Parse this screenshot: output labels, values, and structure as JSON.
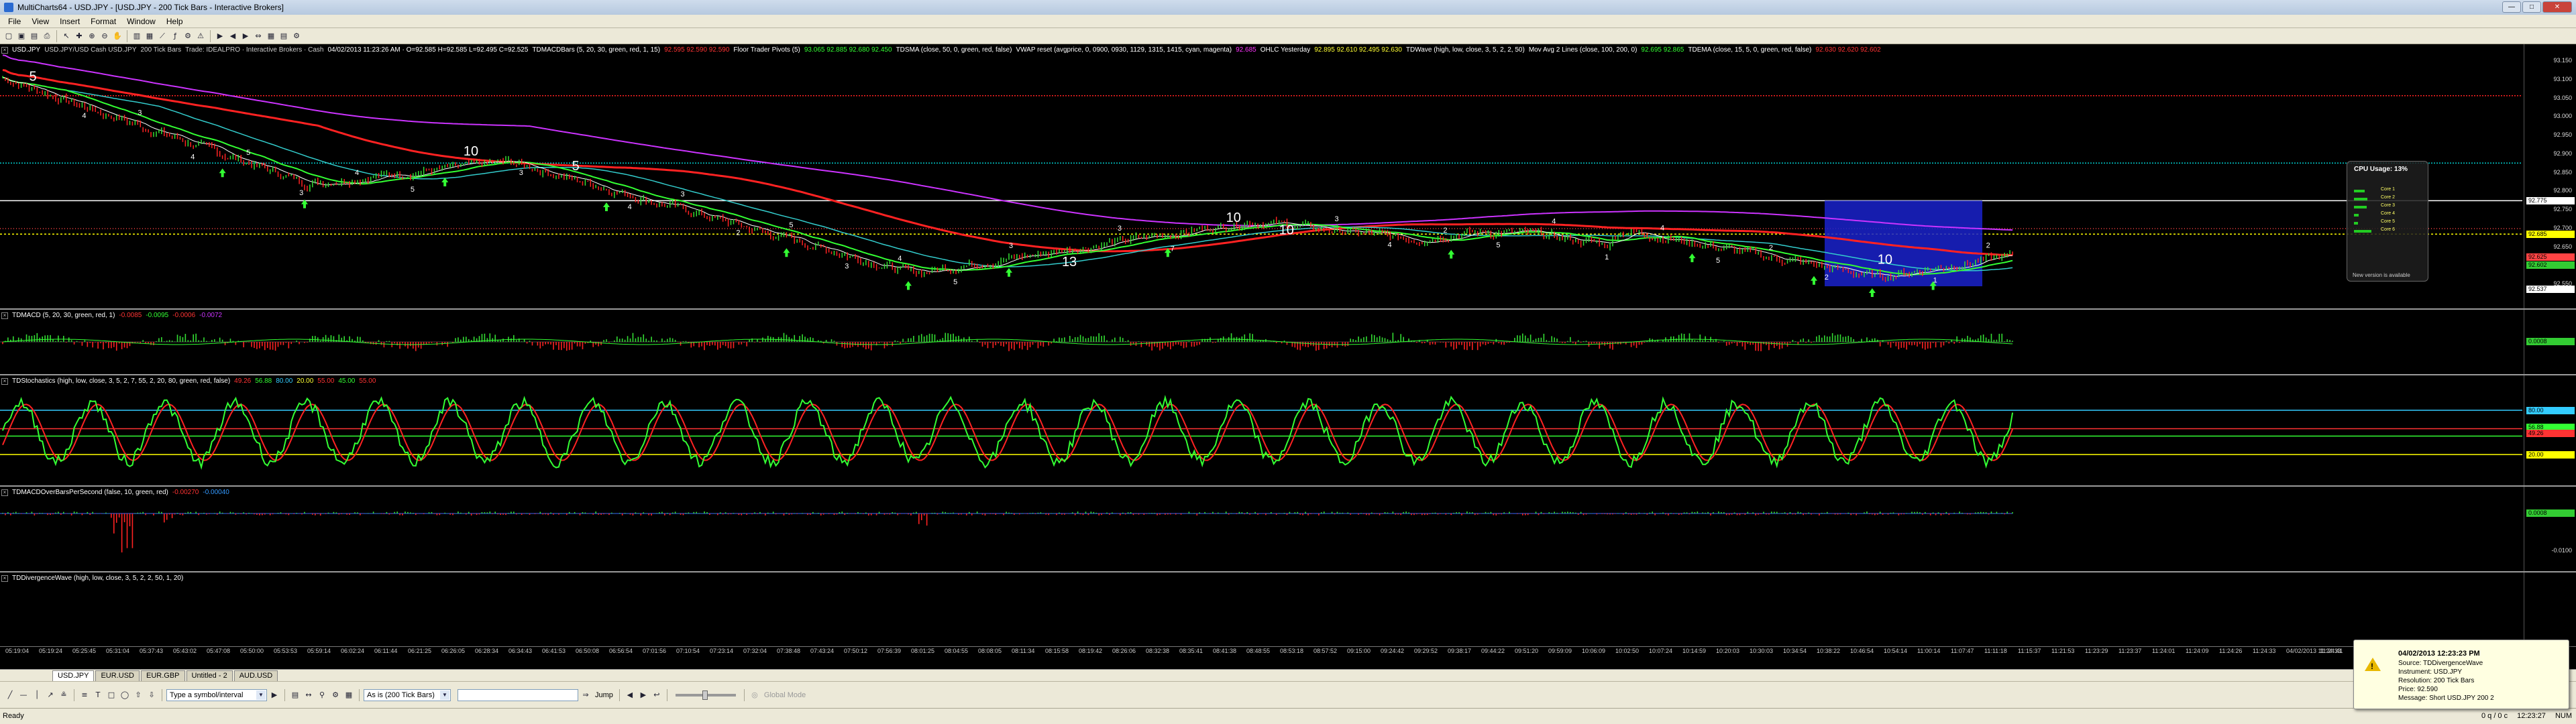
{
  "window": {
    "title": "MultiCharts64 - USD.JPY - [USD.JPY - 200 Tick Bars - Interactive Brokers]",
    "buttons": [
      "minimize",
      "maximize",
      "close"
    ]
  },
  "menu": [
    "File",
    "View",
    "Insert",
    "Format",
    "Window",
    "Help"
  ],
  "toolbar_icons": [
    "new-icon",
    "open-icon",
    "save-icon",
    "print-icon",
    "cursor-icon",
    "crosshair-icon",
    "zoom-in-icon",
    "zoom-out-icon",
    "hand-icon",
    "bars-icon",
    "candles-icon",
    "line-icon",
    "indicator-icon",
    "strategy-icon",
    "alert-icon",
    "play-icon",
    "scroll-left-icon",
    "scroll-right-icon",
    "fit-icon",
    "grid-icon",
    "table-icon",
    "settings-icon"
  ],
  "main_pane": {
    "status_line": [
      {
        "text": "USD.JPY",
        "color": "#ffffff"
      },
      {
        "text": "USD.JPY/USD Cash USD.JPY",
        "color": "#cccccc"
      },
      {
        "text": "200 Tick Bars",
        "color": "#cccccc"
      },
      {
        "text": "Trade: IDEALPRO · Interactive Brokers · Cash",
        "color": "#cccccc"
      },
      {
        "text": "04/02/2013 11:23:26 AM · O=92.585 H=92.585 L=92.495 C=92.525",
        "color": "#ffffff"
      },
      {
        "text": "TDMACDBars (5, 20, 30, green, red, 1, 15)",
        "color": "#ffffff"
      },
      {
        "text": "92.595 92.590 92.590",
        "color": "#ff3333"
      },
      {
        "text": "Floor Trader Pivots (5)",
        "color": "#ffffff"
      },
      {
        "text": "93.065 92.885 92.680 92.450",
        "color": "#33ff33"
      },
      {
        "text": "TDSMA (close, 50, 0, green, red, false)",
        "color": "#ffffff"
      },
      {
        "text": "VWAP reset (avgprice, 0, 0900, 0930, 1129, 1315, 1415, cyan, magenta)",
        "color": "#ffffff"
      },
      {
        "text": "92.685",
        "color": "#ff33ff"
      },
      {
        "text": "OHLC Yesterday",
        "color": "#ffffff"
      },
      {
        "text": "92.895 92.610 92.495 92.630",
        "color": "#ffff33"
      },
      {
        "text": "TDWave (high, low, close, 3, 5, 2, 2, 50)",
        "color": "#ffffff"
      },
      {
        "text": "Mov Avg 2 Lines (close, 100, 200, 0)",
        "color": "#ffffff"
      },
      {
        "text": "92.695 92.865",
        "color": "#33ff33"
      },
      {
        "text": "TDEMA (close, 15, 5, 0, green, red, false)",
        "color": "#ffffff"
      },
      {
        "text": "92.630 92.620 92.602",
        "color": "#ff3333"
      }
    ],
    "price_labels": [
      "93.150",
      "93.100",
      "93.050",
      "93.000",
      "92.950",
      "92.900",
      "92.850",
      "92.800",
      "92.750",
      "92.700",
      "92.650",
      "92.600",
      "92.550"
    ],
    "price_tags": [
      {
        "text": "92.775",
        "color": "#ffffff"
      },
      {
        "text": "92.685",
        "color": "#ffff00"
      },
      {
        "text": "92.625",
        "color": "#ff4444"
      },
      {
        "text": "92.602",
        "color": "#33cc33"
      },
      {
        "text": "92.537",
        "color": "#ffffff"
      }
    ],
    "wave_numbers": [
      "5",
      "4",
      "3",
      "4",
      "5",
      "3",
      "4",
      "5",
      "10",
      "3",
      "5",
      "4",
      "3",
      "2",
      "5",
      "3",
      "4",
      "5",
      "3",
      "13",
      "3",
      "7",
      "10",
      "10",
      "3",
      "4",
      "2",
      "5",
      "4",
      "1",
      "4",
      "5",
      "2",
      "2",
      "10",
      "1",
      "2"
    ]
  },
  "macd_pane": {
    "status_line": [
      {
        "text": "TDMACD (5, 20, 30, green, red, 1)",
        "color": "#ffffff"
      },
      {
        "text": "-0.0085",
        "color": "#ff3333"
      },
      {
        "text": "-0.0095",
        "color": "#33ff33"
      },
      {
        "text": "-0.0006",
        "color": "#ff3333"
      },
      {
        "text": "-0.0072",
        "color": "#cc33ff"
      }
    ],
    "price_tags": [
      {
        "text": "0.0008",
        "color": "#33cc33"
      }
    ]
  },
  "stoch_pane": {
    "status_line": [
      {
        "text": "TDStochastics (high, low, close, 3, 5, 2, 7, 55, 2, 20, 80, green, red, false)",
        "color": "#ffffff"
      },
      {
        "text": "49.26",
        "color": "#ff3333"
      },
      {
        "text": "56.88",
        "color": "#33ff33"
      },
      {
        "text": "80.00",
        "color": "#33ccff"
      },
      {
        "text": "20.00",
        "color": "#ffff33"
      },
      {
        "text": "55.00",
        "color": "#ff3333"
      },
      {
        "text": "45.00",
        "color": "#33ff33"
      },
      {
        "text": "55.00",
        "color": "#ff3333"
      }
    ],
    "price_tags": [
      {
        "text": "80.00",
        "color": "#33ccff"
      },
      {
        "text": "56.88",
        "color": "#33ff33"
      },
      {
        "text": "49.26",
        "color": "#ff3333"
      },
      {
        "text": "20.00",
        "color": "#ffff00"
      }
    ]
  },
  "tick_pane": {
    "status_line": [
      {
        "text": "TDMACDOverBarsPerSecond (false, 10, green, red)",
        "color": "#ffffff"
      },
      {
        "text": "-0.00270",
        "color": "#ff3333"
      },
      {
        "text": "-0.00040",
        "color": "#3399ff"
      }
    ],
    "price_labels": [
      "-0.0100"
    ],
    "price_tags": [
      {
        "text": "0.0008",
        "color": "#33cc33"
      }
    ]
  },
  "divergence_pane": {
    "status_line": [
      {
        "text": "TDDivergenceWave (high, low, close, 3, 5, 2, 2, 50, 1, 20)",
        "color": "#ffffff"
      }
    ]
  },
  "time_axis": [
    "05:19:04",
    "05:19:24",
    "05:25:45",
    "05:31:04",
    "05:37:43",
    "05:43:02",
    "05:47:08",
    "05:50:00",
    "05:53:53",
    "05:59:14",
    "06:02:24",
    "06:11:44",
    "06:21:25",
    "06:26:05",
    "06:28:34",
    "06:34:43",
    "06:41:53",
    "06:50:08",
    "06:56:54",
    "07:01:56",
    "07:10:54",
    "07:23:14",
    "07:32:04",
    "07:38:48",
    "07:43:24",
    "07:50:12",
    "07:56:39",
    "08:01:25",
    "08:04:55",
    "08:08:05",
    "08:11:34",
    "08:15:58",
    "08:19:42",
    "08:26:06",
    "08:32:38",
    "08:35:41",
    "08:41:38",
    "08:48:55",
    "08:53:18",
    "08:57:52",
    "09:15:00",
    "09:24:42",
    "09:29:52",
    "09:38:17",
    "09:44:22",
    "09:51:20",
    "09:59:09",
    "10:06:09",
    "10:02:50",
    "10:07:24",
    "10:14:59",
    "10:20:03",
    "10:30:03",
    "10:34:54",
    "10:38:22",
    "10:46:54",
    "10:54:14",
    "11:00:14",
    "11:07:47",
    "11:11:18",
    "11:15:37",
    "11:21:53",
    "11:23:29",
    "11:23:37",
    "11:24:01",
    "11:24:09",
    "11:24:26",
    "11:24:33",
    "04/02/2013 11:24:33",
    "11:24:41"
  ],
  "sheet_tabs": [
    "USD.JPY",
    "EUR.USD",
    "EUR.GBP",
    "Untitled - 2",
    "AUD.USD"
  ],
  "drawbar": {
    "symbol_placeholder": "Type a symbol/interval",
    "resolution_select": "As is (200 Tick Bars)",
    "jump_label": "Jump",
    "global_mode_label": "Global Mode"
  },
  "status_bar": {
    "ready": "Ready",
    "sb_right": [
      "0 q / 0 c",
      "12:23:27",
      "NUM"
    ]
  },
  "alert": {
    "title": "04/02/2013 12:23:23 PM",
    "lines": [
      "Source: TDDivergenceWave",
      "Instrument: USD.JPY",
      "Resolution: 200 Tick Bars",
      "Price: 92.590",
      "Message: Short USD.JPY 200 2"
    ]
  },
  "cpu_widget": {
    "title": "CPU Usage: 13%",
    "cores": [
      {
        "name": "Core 1",
        "value": 0.13
      },
      {
        "name": "Core 2",
        "value": 0.17
      },
      {
        "name": "Core 3",
        "value": 0.16
      },
      {
        "name": "Core 4",
        "value": 0.06
      },
      {
        "name": "Core 5",
        "value": 0.05
      },
      {
        "name": "Core 6",
        "value": 0.22
      }
    ],
    "footer": "New version is available"
  },
  "colors": {
    "bull": "#33dd33",
    "bear": "#ff2222",
    "highlight_box": "#1a22cc",
    "background": "#000000"
  }
}
